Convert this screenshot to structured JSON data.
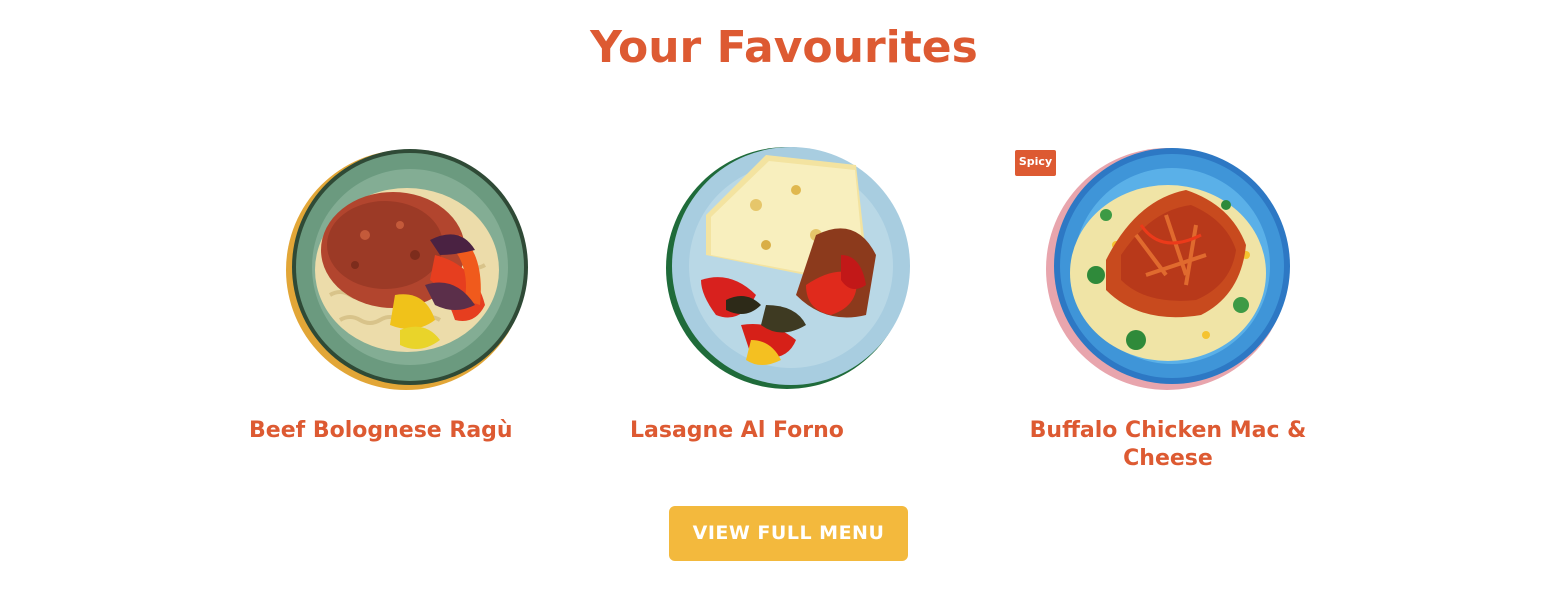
{
  "section": {
    "title": "Your Favourites"
  },
  "dishes": [
    {
      "name": "Beef Bolognese Ragù",
      "badge": ""
    },
    {
      "name": "Lasagne Al Forno",
      "badge": ""
    },
    {
      "name": "Buffalo Chicken Mac & Cheese",
      "badge": "Spicy"
    }
  ],
  "cta": {
    "label": "VIEW FULL MENU"
  },
  "colors": {
    "accent": "#dd5a32",
    "button": "#f3b93d",
    "plate_1": "#6b9a7f",
    "plate_2": "#a8cde0",
    "plate_3": "#3f95d8"
  }
}
